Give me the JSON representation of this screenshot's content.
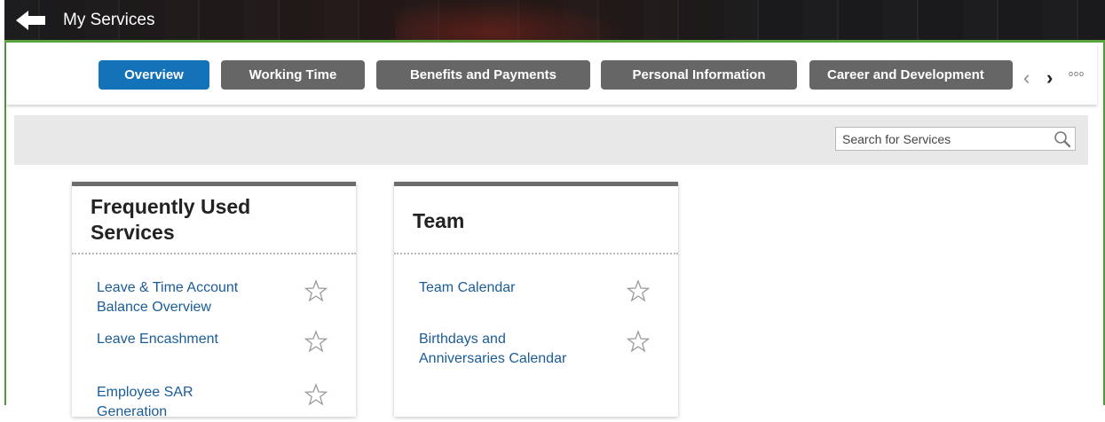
{
  "header": {
    "title": "My Services"
  },
  "tabs": [
    {
      "label": "Overview",
      "active": true
    },
    {
      "label": "Working Time",
      "active": false
    },
    {
      "label": "Benefits and Payments",
      "active": false
    },
    {
      "label": "Personal Information",
      "active": false
    },
    {
      "label": "Career and Development",
      "active": false
    }
  ],
  "tab_nav": {
    "prev": "‹",
    "next": "›",
    "more": "ooo"
  },
  "search": {
    "placeholder": "Search for Services",
    "value": ""
  },
  "cards": [
    {
      "title": "Frequently Used Services",
      "title_lines": [
        "Frequently Used",
        "Services"
      ],
      "items": [
        {
          "label": "Leave & Time Account Balance Overview",
          "lines": [
            "Leave & Time Account",
            "Balance Overview"
          ]
        },
        {
          "label": "Leave Encashment",
          "lines": [
            "Leave Encashment"
          ]
        },
        {
          "label": "Employee SAR Generation",
          "lines": [
            "Employee SAR",
            "Generation"
          ]
        }
      ]
    },
    {
      "title": "Team",
      "title_lines": [
        "Team"
      ],
      "items": [
        {
          "label": "Team Calendar",
          "lines": [
            "Team Calendar"
          ]
        },
        {
          "label": "Birthdays and Anniversaries Calendar",
          "lines": [
            "Birthdays and",
            "Anniversaries Calendar"
          ]
        }
      ]
    }
  ],
  "colors": {
    "accent": "#1473b8",
    "tab_inactive": "#666666",
    "link": "#1a5c98",
    "frame": "#5aa33f"
  },
  "icons": {
    "back": "arrow-left-icon",
    "search": "magnifier-icon",
    "favorite": "star-outline-icon"
  }
}
